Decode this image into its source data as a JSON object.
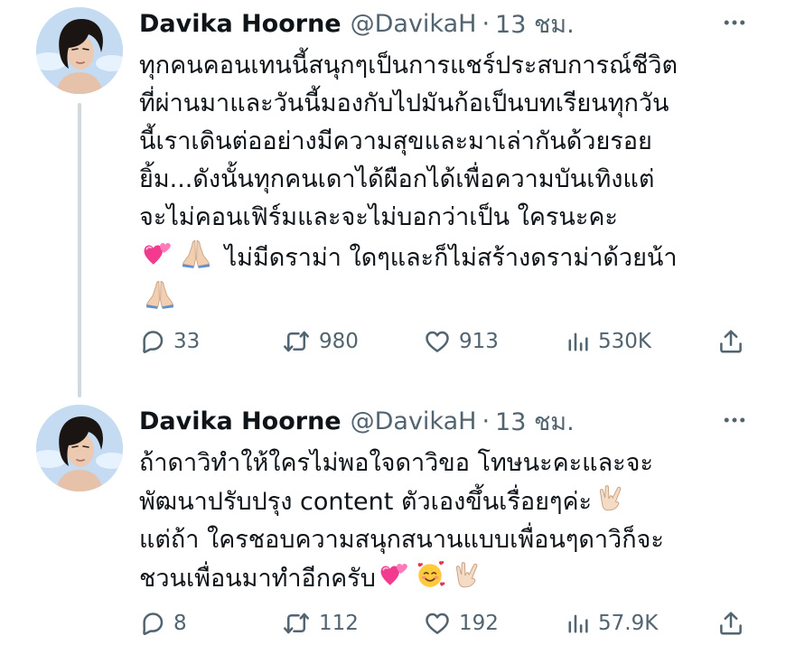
{
  "tweets": [
    {
      "author_name": "Davika Hoorne",
      "handle": "@DavikaH",
      "separator": "·",
      "time": "13 ชม.",
      "lines": [
        "ทุกคนคอนเทนนี้สนุกๆเป็นการแชร์ประสบการณ์ชีวิต",
        "ที่ผ่านมาและวันนี้มองกับไปมันก้อเป็นบทเรียนทุกวัน",
        "นี้เราเดินต่ออย่างมีความสุขและมาเล่ากันด้วยรอย",
        "ยิ้ม...ดังนั้นทุกคนเดาได้ผือกได้เพื่อความบันเทิงแต่",
        "จะไม่คอนเฟิร์มและจะไม่บอกว่าเป็น ใครนะคะ",
        "ไม่มีดราม่า ใดๆและก็ไม่สร้างดราม่าด้วยน้า"
      ],
      "line_emojis": [
        "two-hearts-emoji",
        "folded-hands-emoji"
      ],
      "trailing_emoji": "folded-hands-emoji",
      "reply_count": "33",
      "retweet_count": "980",
      "like_count": "913",
      "view_count": "530K"
    },
    {
      "author_name": "Davika Hoorne",
      "handle": "@DavikaH",
      "separator": "·",
      "time": "13 ชม.",
      "lines": [
        "ถ้าดาวิทำให้ใครไม่พอใจดาวิขอ โทษนะคะและจะ",
        "พัฒนาปรับปรุง content ตัวเองขึ้นเรื่อยๆค่ะ",
        "แต่ถ้า ใครชอบความสนุกสนานแบบเพื่อนๆดาวิก็จะ",
        "ชวนเพื่อนมาทำอีกครับ"
      ],
      "line2_emoji": "love-you-gesture-emoji",
      "line4_emojis": [
        "two-hearts-emoji",
        "smiling-face-with-hearts-emoji",
        "love-you-gesture-emoji"
      ],
      "reply_count": "8",
      "retweet_count": "112",
      "like_count": "192",
      "view_count": "57.9K"
    }
  ],
  "icons": {
    "reply": "reply-icon",
    "retweet": "retweet-icon",
    "like": "heart-icon",
    "views": "views-icon",
    "share": "share-icon",
    "more": "more-icon"
  },
  "colors": {
    "text": "#0f1419",
    "secondary": "#536471",
    "thread_line": "#cfd9de",
    "heart_pink": "#f91880"
  }
}
